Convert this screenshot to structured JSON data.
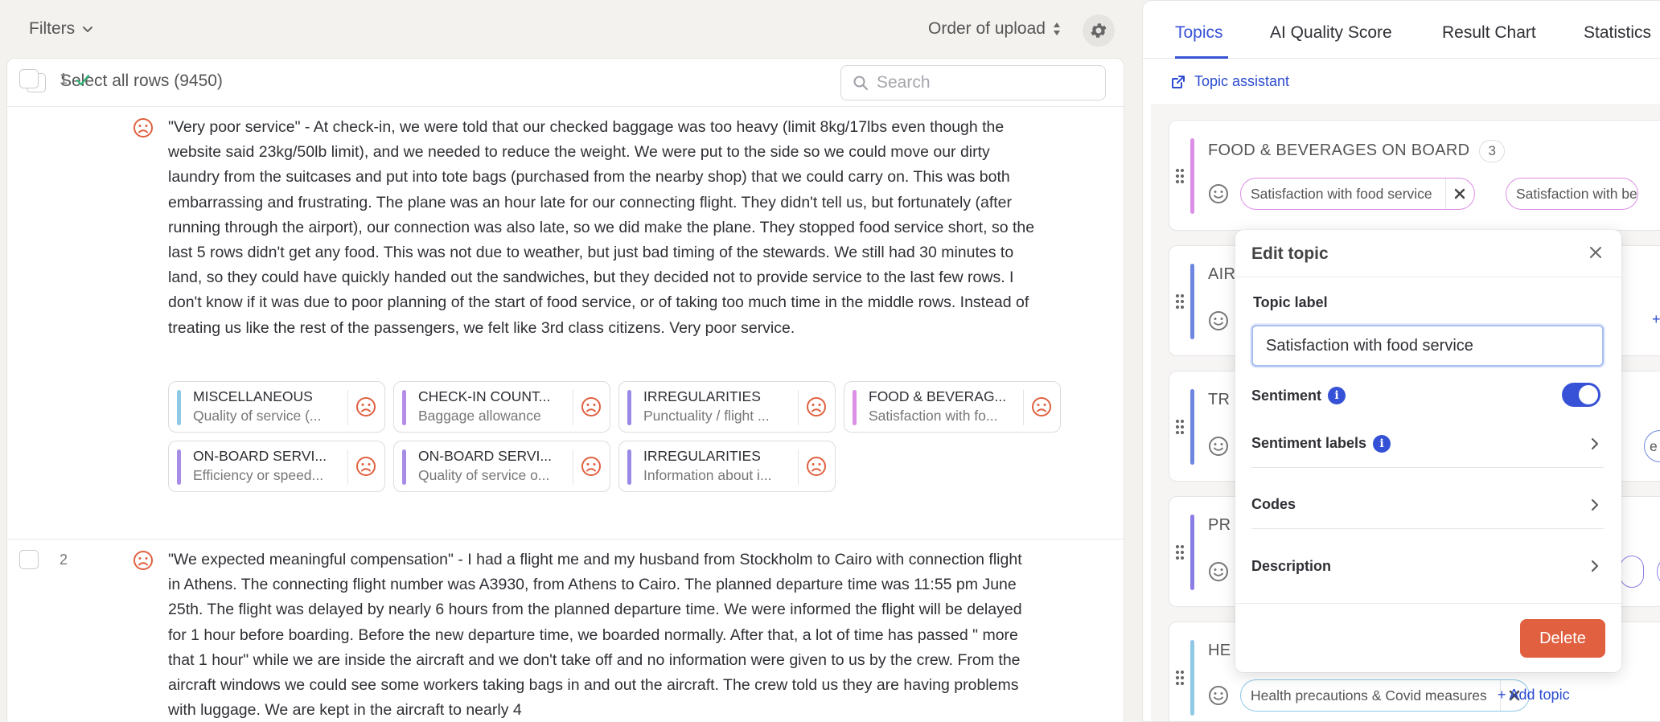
{
  "toolbar": {
    "filters_label": "Filters",
    "order_label": "Order of upload"
  },
  "list": {
    "select_all_label": "Select all rows (9450)",
    "search_placeholder": "Search"
  },
  "rows": [
    {
      "number": "1",
      "text": "\"Very poor service\" - At check-in, we were told that our checked baggage was too heavy (limit 8kg/17lbs even though the website said 23kg/50lb limit), and we needed to reduce the weight. We were put to the side so we could move our dirty laundry from the suitcases and put into tote bags (purchased from the nearby shop) that we could carry on. This was both embarrassing and frustrating. The plane was an hour late for our connecting flight. They didn't tell us, but fortunately (after running through the airport), our connection was also late, so we did make the plane. They stopped food service short, so the last 5 rows didn't get any food. This was not due to weather, but just bad timing of the stewards. We still had 30 minutes to land, so they could have quickly handed out the sandwiches, but they decided not to provide service to the last few rows. I don't know if it was due to poor planning of the start of food service, or of taking too much time in the middle rows. Instead of treating us like the rest of the passengers, we felt like 3rd class citizens. Very poor service.",
      "chips": [
        {
          "title": "MISCELLANEOUS",
          "sub": "Quality of service (...",
          "color": "#8fc9e6"
        },
        {
          "title": "CHECK-IN COUNT...",
          "sub": "Baggage allowance",
          "color": "#b48de6"
        },
        {
          "title": "IRREGULARITIES",
          "sub": "Punctuality / flight ...",
          "color": "#9a8ae6"
        },
        {
          "title": "FOOD & BEVERAG...",
          "sub": "Satisfaction with fo...",
          "color": "#dc8fe6"
        },
        {
          "title": "ON-BOARD SERVI...",
          "sub": "Efficiency or speed...",
          "color": "#a88de6"
        },
        {
          "title": "ON-BOARD SERVI...",
          "sub": "Quality of service o...",
          "color": "#a88de6"
        },
        {
          "title": "IRREGULARITIES",
          "sub": "Information about i...",
          "color": "#9a8ae6"
        }
      ]
    },
    {
      "number": "2",
      "text": "\"We expected meaningful compensation\" - I had a flight me and my husband from Stockholm to Cairo with connection flight in Athens. The connecting flight number was A3930, from Athens to Cairo. The planned departure time was 11:55 pm June 25th. The flight was delayed by nearly 6 hours from the planned departure time. We were informed the flight will be delayed for 1 hour before boarding. Before the new departure time, we boarded normally. After that, a lot of time has passed \" more that 1 hour\" while we are inside the aircraft and we don't take off and no information were given to us by the crew. From the aircraft windows we could see some workers taking bags in and out the aircraft. The crew told us they are having problems with luggage. We are kept in the aircraft to nearly 4"
    }
  ],
  "tabs": [
    "Topics",
    "AI Quality Score",
    "Result Chart",
    "Statistics"
  ],
  "topic_assistant_label": "Topic assistant",
  "topic_cards": [
    {
      "title": "FOOD & BEVERAGES ON BOARD",
      "count": "3",
      "color": "#dc8fe6"
    },
    {
      "title": "AIR",
      "color": "#6d86e0"
    },
    {
      "title": "TR",
      "color": "#6d86e0"
    },
    {
      "title": "PR",
      "color": "#8a7ee6"
    },
    {
      "title": "HE",
      "color": "#8fc9e6"
    }
  ],
  "topic_pills": {
    "food_1": "Satisfaction with food service",
    "food_2": "Satisfaction with be",
    "health_1": "Health precautions & Covid measures",
    "tr_partial": "e to ca",
    "add_topic": "+ Add topic",
    "add_partial": "+ A"
  },
  "edit_topic": {
    "title": "Edit topic",
    "label_heading": "Topic label",
    "label_value": "Satisfaction with food service",
    "sentiment": "Sentiment",
    "sentiment_labels": "Sentiment labels",
    "codes": "Codes",
    "description": "Description",
    "delete": "Delete",
    "sentiment_enabled": true
  },
  "colors": {
    "accent": "#3752d6",
    "danger": "#e0603f",
    "negative": "#e0603f"
  }
}
